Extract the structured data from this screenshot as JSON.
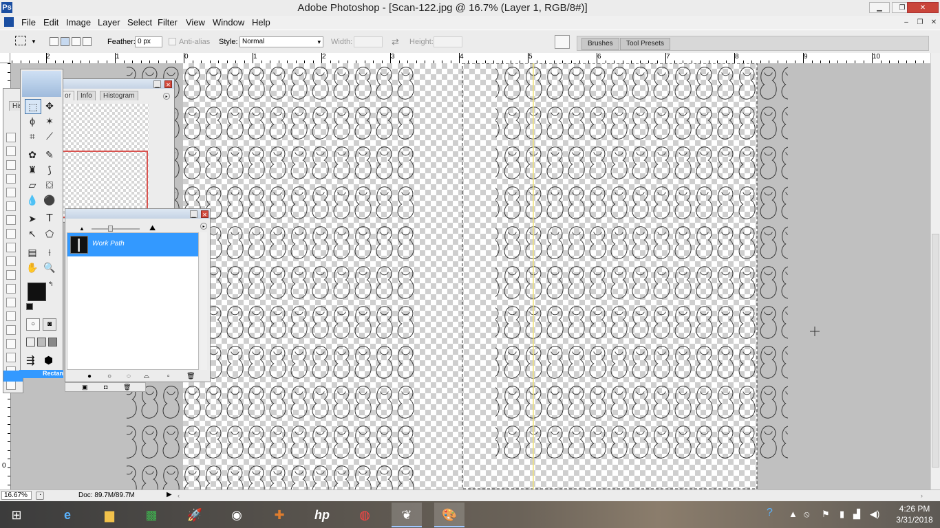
{
  "window": {
    "title": "Adobe Photoshop - [Scan-122.jpg @ 16.7% (Layer 1, RGB/8#)]",
    "logo_text": "Ps",
    "controls": {
      "minimize": "▁",
      "maximize": "❐",
      "close": "✕"
    },
    "doc_controls": {
      "minimize": "–",
      "restore": "❐",
      "close": "✕"
    }
  },
  "menu": [
    "File",
    "Edit",
    "Image",
    "Layer",
    "Select",
    "Filter",
    "View",
    "Window",
    "Help"
  ],
  "options": {
    "feather_label": "Feather:",
    "feather_value": "0 px",
    "antialias_label": "Anti-alias",
    "style_label": "Style:",
    "style_value": "Normal",
    "width_label": "Width:",
    "height_label": "Height:",
    "swap_icon": "⇄",
    "well_tabs": [
      "Brushes",
      "Tool Presets"
    ]
  },
  "rulers": {
    "h_labels": [
      "2",
      "1",
      "0",
      "1",
      "2",
      "3",
      "4",
      "5",
      "6",
      "7",
      "8",
      "9",
      "10"
    ],
    "v_labels": [
      "0"
    ]
  },
  "panels": {
    "navigator": {
      "tabs": [
        "or",
        "Info",
        "Histogram"
      ]
    },
    "paths": {
      "item": "Work Path"
    },
    "history": {
      "tab": "His",
      "item": "Rectan"
    }
  },
  "status": {
    "zoom": "16.67%",
    "doc": "Doc: 89.7M/89.7M"
  },
  "taskbar": {
    "time": "4:26 PM",
    "date": "3/31/2018",
    "hp_label": "hp"
  },
  "colors": {
    "accent": "#3399ff",
    "foreground_swatch": "#111111",
    "guide": "#f0e27a",
    "selection_border": "#333333"
  }
}
